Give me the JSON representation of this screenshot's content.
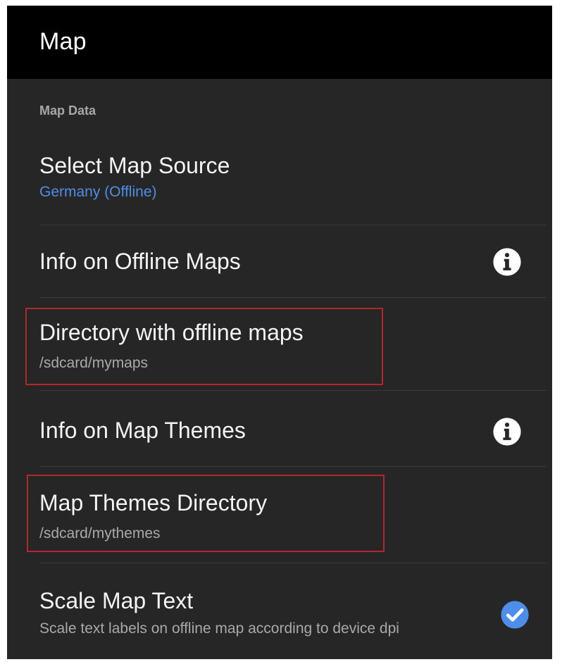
{
  "app_bar": {
    "title": "Map"
  },
  "section": {
    "header": "Map Data"
  },
  "preferences": [
    {
      "title": "Select Map Source",
      "summary": "Germany (Offline)",
      "summary_color": "#4f8ee8"
    },
    {
      "title": "Info on Offline Maps",
      "icon": "info-icon"
    },
    {
      "title": "Directory with offline maps",
      "summary": "/sdcard/mymaps",
      "highlighted": true
    },
    {
      "title": "Info on Map Themes",
      "icon": "info-icon"
    },
    {
      "title": "Map Themes Directory",
      "summary": "/sdcard/mythemes",
      "highlighted": true
    },
    {
      "title": "Scale Map Text",
      "summary": "Scale text labels on offline map according to device dpi",
      "checked": true,
      "icon": "check-circle-icon"
    }
  ],
  "colors": {
    "background": "#262626",
    "app_bar": "#000000",
    "accent": "#4f8ee8",
    "highlight_border": "#b2262d",
    "check_fill": "#4f8ee8"
  }
}
